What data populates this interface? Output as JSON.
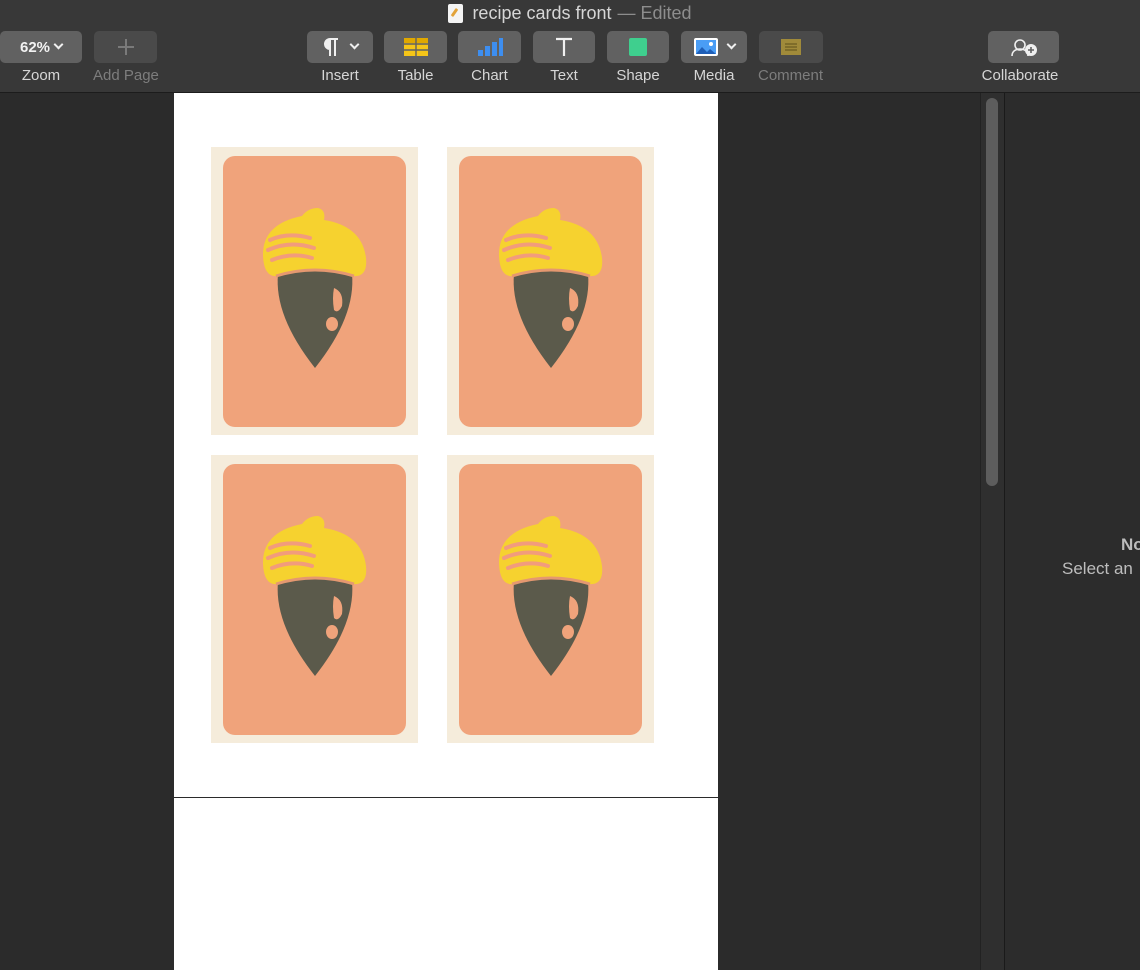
{
  "window": {
    "doc_title": "recipe cards front",
    "status": "— Edited"
  },
  "toolbar": {
    "zoom": {
      "value": "62%",
      "label": "Zoom"
    },
    "add_page": {
      "label": "Add Page"
    },
    "insert": {
      "label": "Insert"
    },
    "table": {
      "label": "Table"
    },
    "chart": {
      "label": "Chart"
    },
    "text": {
      "label": "Text"
    },
    "shape": {
      "label": "Shape"
    },
    "media": {
      "label": "Media"
    },
    "comment": {
      "label": "Comment"
    },
    "collaborate": {
      "label": "Collaborate"
    }
  },
  "document": {
    "cards": [
      {
        "image": "acorn-illustration"
      },
      {
        "image": "acorn-illustration"
      },
      {
        "image": "acorn-illustration"
      },
      {
        "image": "acorn-illustration"
      }
    ],
    "colors": {
      "card_border": "#f5ecdb",
      "card_fill": "#f0a37b",
      "acorn_cap": "#f6d22f",
      "acorn_body": "#5b5a4b"
    }
  },
  "sidebar": {
    "title": "No",
    "subtitle": "Select an"
  }
}
